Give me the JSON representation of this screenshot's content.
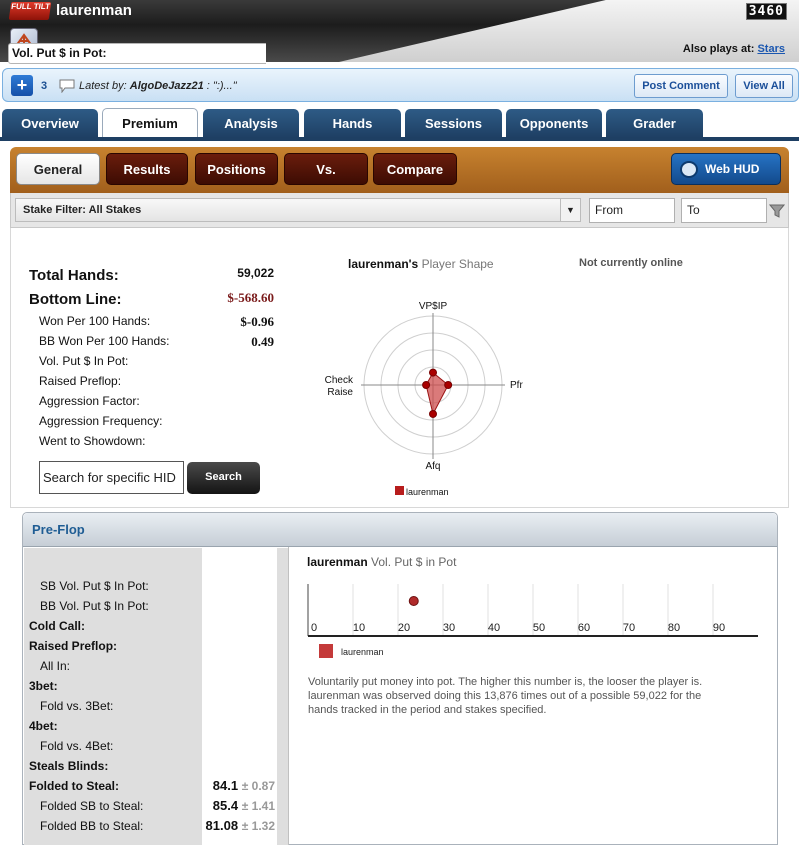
{
  "header": {
    "logo_text": "FULL TILT",
    "username": "laurenman",
    "counter": "3460",
    "also_plays_label": "Also plays at:",
    "also_plays_link": "Stars"
  },
  "comments": {
    "count": "3",
    "latest_label": "Latest by:",
    "latest_author": "AlgoDeJazz21",
    "latest_text": " : \":)...\"",
    "post_comment": "Post Comment",
    "view_all": "View All"
  },
  "tabs": [
    "Overview",
    "Premium",
    "Analysis",
    "Hands",
    "Sessions",
    "Opponents",
    "Grader"
  ],
  "active_tab": "Premium",
  "subtabs": [
    "General",
    "Results",
    "Positions",
    "Vs.",
    "Compare"
  ],
  "active_subtab": "General",
  "web_hud": "Web HUD",
  "filter": {
    "stake_filter": "Stake Filter: All Stakes",
    "from": "From",
    "to": "To"
  },
  "stats": {
    "total_hands_label": "Total Hands:",
    "total_hands": "59,022",
    "bottom_line_label": "Bottom Line:",
    "bottom_line": "$-568.60",
    "rows": [
      {
        "label": "Won Per 100 Hands:",
        "value": "$-0.96"
      },
      {
        "label": "BB Won Per 100 Hands:",
        "value": "0.49"
      },
      {
        "label": "Vol. Put $ In Pot:",
        "value": ""
      },
      {
        "label": "Raised Preflop:",
        "value": ""
      },
      {
        "label": "Aggression Factor:",
        "value": ""
      },
      {
        "label": "Aggression Frequency:",
        "value": ""
      },
      {
        "label": "Went to Showdown:",
        "value": ""
      }
    ],
    "search_placeholder": "Search for specific HID",
    "search_button": "Search"
  },
  "player_shape": {
    "player": "laurenman's",
    "title": "Player Shape",
    "online_status": "Not currently online",
    "axes": [
      "VP$IP",
      "Pfr",
      "Afq",
      "Check Raise"
    ],
    "axis_check_line1": "Check",
    "axis_check_line2": "Raise",
    "values": [
      0.18,
      0.22,
      0.42,
      0.1
    ],
    "legend": "laurenman",
    "series_color": "#b71c1c"
  },
  "preflop": {
    "title": "Pre-Flop",
    "rows": [
      {
        "label": "Vol. Put $ in Pot:",
        "bold": true,
        "indent": false,
        "value": "",
        "pm": ""
      },
      {
        "label": "SB Vol. Put $ In Pot:",
        "bold": false,
        "indent": true,
        "value": "",
        "pm": ""
      },
      {
        "label": "BB Vol. Put $ In Pot:",
        "bold": false,
        "indent": true,
        "value": "",
        "pm": ""
      },
      {
        "label": "Cold Call:",
        "bold": true,
        "indent": false,
        "value": "",
        "pm": ""
      },
      {
        "label": "Raised Preflop:",
        "bold": true,
        "indent": false,
        "value": "",
        "pm": ""
      },
      {
        "label": "All In:",
        "bold": false,
        "indent": true,
        "value": "",
        "pm": ""
      },
      {
        "label": "3bet:",
        "bold": true,
        "indent": false,
        "value": "",
        "pm": ""
      },
      {
        "label": "Fold vs. 3Bet:",
        "bold": false,
        "indent": true,
        "value": "",
        "pm": ""
      },
      {
        "label": "4bet:",
        "bold": true,
        "indent": false,
        "value": "",
        "pm": ""
      },
      {
        "label": "Fold vs. 4Bet:",
        "bold": false,
        "indent": true,
        "value": "",
        "pm": ""
      },
      {
        "label": "Steals Blinds:",
        "bold": true,
        "indent": false,
        "value": "",
        "pm": ""
      },
      {
        "label": "Folded to Steal:",
        "bold": true,
        "indent": false,
        "value": "84.1",
        "pm": "± 0.87"
      },
      {
        "label": "Folded SB to Steal:",
        "bold": false,
        "indent": true,
        "value": "85.4",
        "pm": "± 1.41"
      },
      {
        "label": "Folded BB to Steal:",
        "bold": false,
        "indent": true,
        "value": "81.08",
        "pm": "± 1.32"
      }
    ]
  },
  "chart_data": {
    "type": "scatter",
    "title_player": "laurenman",
    "title": "Vol. Put $ in Pot",
    "x_ticks": [
      0,
      10,
      20,
      30,
      40,
      50,
      60,
      70,
      80,
      90
    ],
    "xlim": [
      0,
      100
    ],
    "series": [
      {
        "name": "laurenman",
        "x": [
          23.5
        ],
        "color": "#b02a2a"
      }
    ],
    "legend": "laurenman",
    "description": "Voluntarily put money into pot. The higher this number is, the looser the player is. laurenman was observed doing this 13,876 times out of a possible 59,022 for the hands tracked in the period and stakes specified."
  }
}
